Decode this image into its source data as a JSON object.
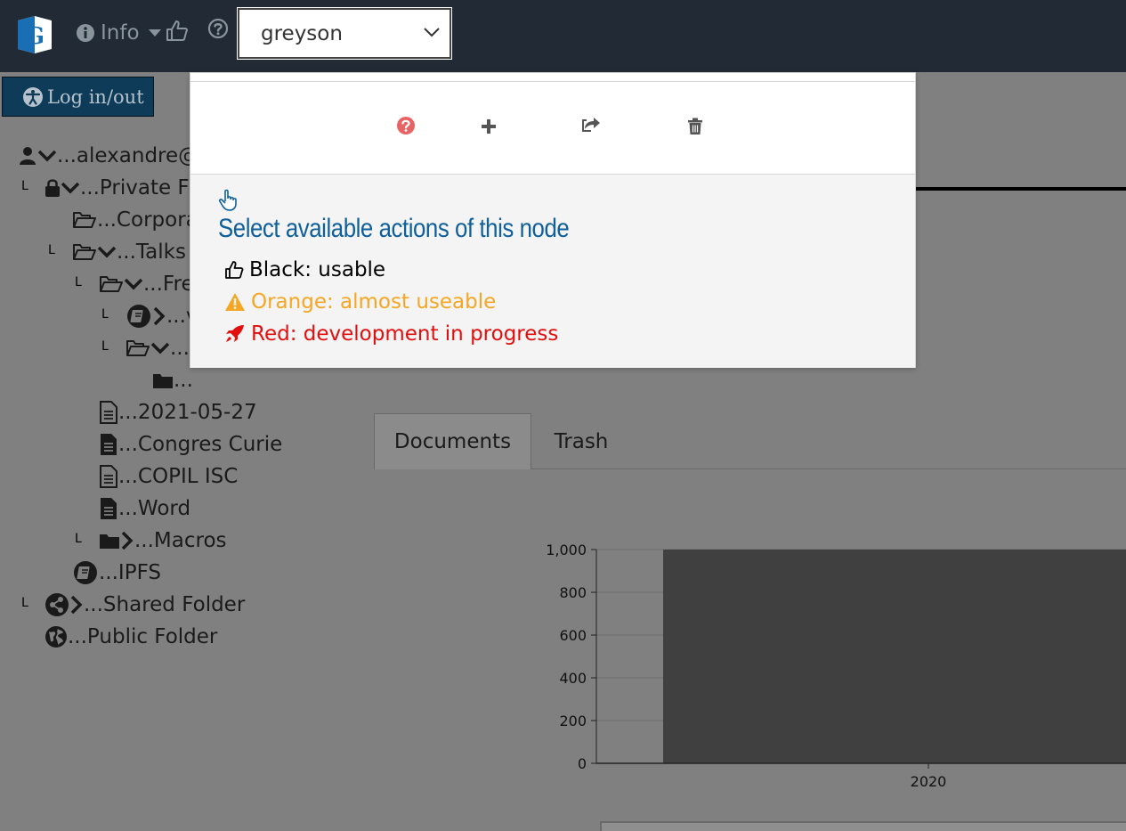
{
  "navbar": {
    "brand_letter": "G",
    "info_label": "Info",
    "user_select": {
      "value": "greyson"
    }
  },
  "login": {
    "label": "Log in/out"
  },
  "tree": {
    "rows": [
      {
        "label": "...alexandre@"
      },
      {
        "label": "...Private Fo"
      },
      {
        "label": "...Corpora"
      },
      {
        "label": "...Talks"
      },
      {
        "label": "...Fre"
      },
      {
        "label": "...v"
      },
      {
        "label": "..."
      },
      {
        "label": "..."
      },
      {
        "label": "...2021-05-27"
      },
      {
        "label": "...Congres Curie"
      },
      {
        "label": "...COPIL ISC"
      },
      {
        "label": "...Word"
      },
      {
        "label": "...Macros"
      },
      {
        "label": "...IPFS"
      },
      {
        "label": "...Shared Folder"
      },
      {
        "label": "...Public Folder"
      }
    ],
    "branch_marker": "L"
  },
  "popover": {
    "help_title": "Select available actions of this node",
    "legend": [
      {
        "text": "Black: usable",
        "color": "#000000"
      },
      {
        "text": "Orange: almost useable",
        "color": "#f5a623"
      },
      {
        "text": "Red: development in progress",
        "color": "#e30e0e"
      }
    ]
  },
  "tabs": [
    {
      "label": "Documents",
      "active": true
    },
    {
      "label": "Trash",
      "active": false
    }
  ],
  "chart_data": {
    "type": "bar",
    "categories": [
      "2020"
    ],
    "values": [
      1000
    ],
    "ylim": [
      0,
      1000
    ],
    "yticks": [
      "0",
      "200",
      "400",
      "600",
      "800",
      "1,000"
    ],
    "title": "",
    "xlabel": "",
    "ylabel": "",
    "bar_color": "#404040",
    "grid": true
  },
  "colors": {
    "navbar": "#222b35",
    "login_bg": "#0d3b58",
    "help_title": "#0f5f9a",
    "question_icon": "#e86363"
  }
}
